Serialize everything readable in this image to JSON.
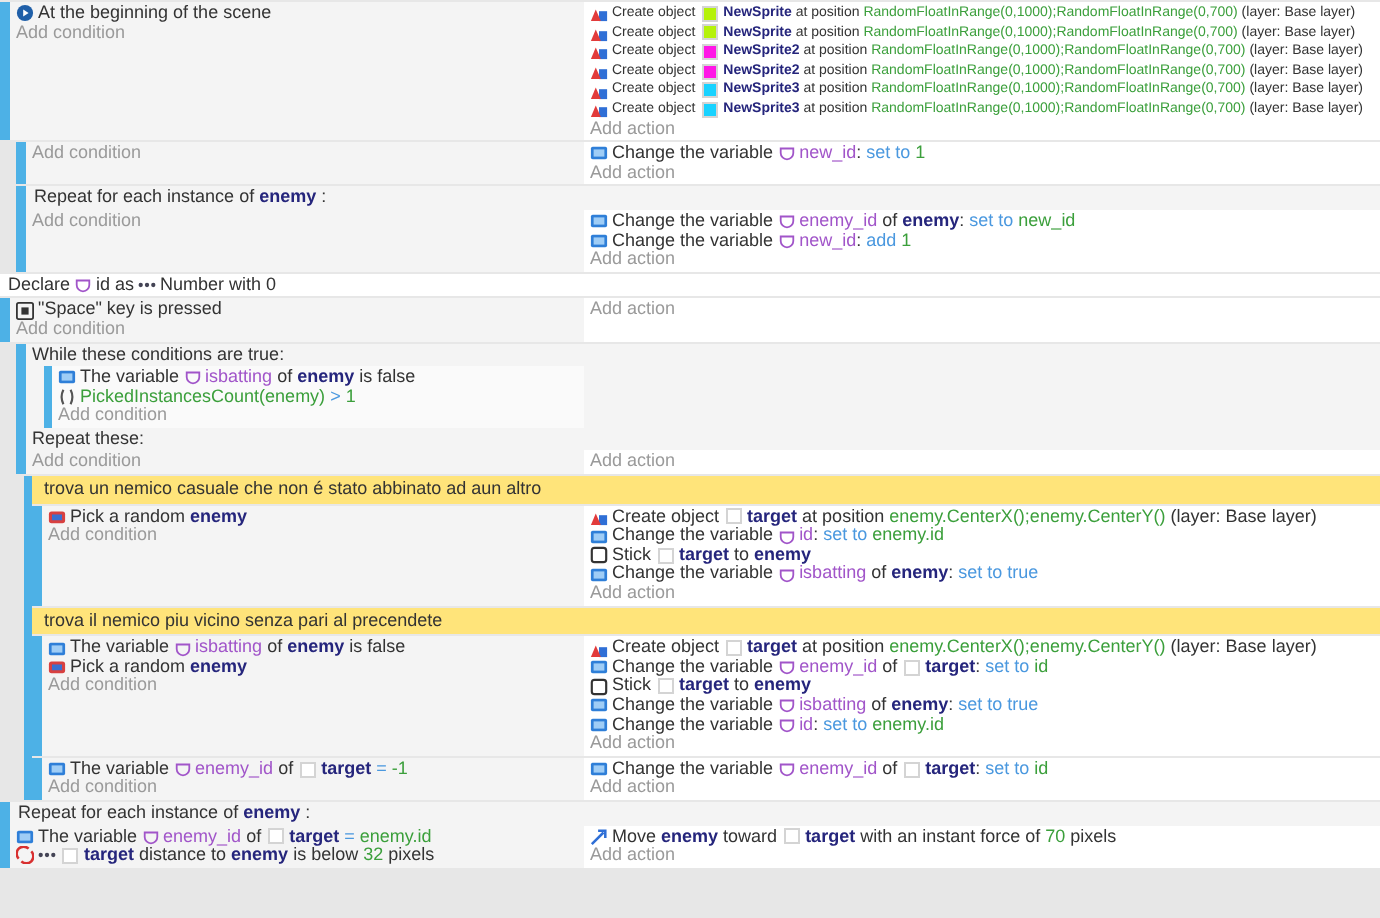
{
  "events": [
    {
      "kind": "standard",
      "conditions": [
        {
          "parts": [
            {
              "kind": "trigger"
            },
            {
              "kind": "text",
              "text": "At the beginning of the scene"
            }
          ]
        }
      ],
      "add_condition": "Add condition",
      "actions": [
        {
          "parts": [
            {
              "kind": "create"
            },
            {
              "kind": "text",
              "text": "Create object"
            },
            {
              "kind": "swatch",
              "color": "#b5f20a"
            },
            {
              "kind": "obj",
              "text": "NewSprite"
            },
            {
              "kind": "text",
              "text": " at position "
            },
            {
              "kind": "expr",
              "text": "RandomFloatInRange(0,1000);RandomFloatInRange(0,700)"
            },
            {
              "kind": "text",
              "text": " (layer: Base layer)"
            }
          ]
        },
        {
          "parts": [
            {
              "kind": "create"
            },
            {
              "kind": "text",
              "text": "Create object"
            },
            {
              "kind": "swatch",
              "color": "#b5f20a"
            },
            {
              "kind": "obj",
              "text": "NewSprite"
            },
            {
              "kind": "text",
              "text": " at position "
            },
            {
              "kind": "expr",
              "text": "RandomFloatInRange(0,1000);RandomFloatInRange(0,700)"
            },
            {
              "kind": "text",
              "text": " (layer: Base layer)"
            }
          ]
        },
        {
          "parts": [
            {
              "kind": "create"
            },
            {
              "kind": "text",
              "text": "Create object"
            },
            {
              "kind": "swatch",
              "color": "#ff16e6"
            },
            {
              "kind": "obj",
              "text": "NewSprite2"
            },
            {
              "kind": "text",
              "text": " at position "
            },
            {
              "kind": "expr",
              "text": "RandomFloatInRange(0,1000);RandomFloatInRange(0,700)"
            },
            {
              "kind": "text",
              "text": " (layer: Base layer)"
            }
          ]
        },
        {
          "parts": [
            {
              "kind": "create"
            },
            {
              "kind": "text",
              "text": "Create object"
            },
            {
              "kind": "swatch",
              "color": "#ff16e6"
            },
            {
              "kind": "obj",
              "text": "NewSprite2"
            },
            {
              "kind": "text",
              "text": " at position "
            },
            {
              "kind": "expr",
              "text": "RandomFloatInRange(0,1000);RandomFloatInRange(0,700)"
            },
            {
              "kind": "text",
              "text": " (layer: Base layer)"
            }
          ]
        },
        {
          "parts": [
            {
              "kind": "create"
            },
            {
              "kind": "text",
              "text": "Create object"
            },
            {
              "kind": "swatch",
              "color": "#18d2ff"
            },
            {
              "kind": "obj",
              "text": "NewSprite3"
            },
            {
              "kind": "text",
              "text": " at position "
            },
            {
              "kind": "expr",
              "text": "RandomFloatInRange(0,1000);RandomFloatInRange(0,700)"
            },
            {
              "kind": "text",
              "text": " (layer: Base layer)"
            }
          ]
        },
        {
          "parts": [
            {
              "kind": "create"
            },
            {
              "kind": "text",
              "text": "Create object"
            },
            {
              "kind": "swatch",
              "color": "#18d2ff"
            },
            {
              "kind": "obj",
              "text": "NewSprite3"
            },
            {
              "kind": "text",
              "text": " at position "
            },
            {
              "kind": "expr",
              "text": "RandomFloatInRange(0,1000);RandomFloatInRange(0,700)"
            },
            {
              "kind": "text",
              "text": " (layer: Base layer)"
            }
          ]
        }
      ],
      "add_action": "Add action",
      "children": [
        {
          "kind": "standard",
          "add_condition": "Add condition",
          "actions": [
            {
              "parts": [
                {
                  "kind": "variable"
                },
                {
                  "kind": "text",
                  "text": "Change the variable"
                },
                {
                  "kind": "scope"
                },
                {
                  "kind": "var",
                  "text": "new_id"
                },
                {
                  "kind": "text",
                  "text": ": "
                },
                {
                  "kind": "op",
                  "text": "set to "
                },
                {
                  "kind": "expr",
                  "text": "1"
                }
              ]
            }
          ],
          "add_action": "Add action"
        },
        {
          "kind": "repeat",
          "header": [
            {
              "kind": "text",
              "text": "Repeat for each instance of "
            },
            {
              "kind": "obj",
              "text": "enemy"
            },
            {
              "kind": "text",
              "text": " :"
            }
          ],
          "add_condition": "Add condition",
          "actions": [
            {
              "parts": [
                {
                  "kind": "variable"
                },
                {
                  "kind": "text",
                  "text": "Change the variable"
                },
                {
                  "kind": "scope"
                },
                {
                  "kind": "var",
                  "text": "enemy_id"
                },
                {
                  "kind": "text",
                  "text": " of "
                },
                {
                  "kind": "obj",
                  "text": "enemy"
                },
                {
                  "kind": "text",
                  "text": ": "
                },
                {
                  "kind": "op",
                  "text": "set to "
                },
                {
                  "kind": "expr",
                  "text": "new_id"
                }
              ]
            },
            {
              "parts": [
                {
                  "kind": "variable"
                },
                {
                  "kind": "text",
                  "text": "Change the variable"
                },
                {
                  "kind": "scope"
                },
                {
                  "kind": "var",
                  "text": "new_id"
                },
                {
                  "kind": "text",
                  "text": ": "
                },
                {
                  "kind": "op",
                  "text": "add "
                },
                {
                  "kind": "expr",
                  "text": "1"
                }
              ]
            }
          ],
          "add_action": "Add action"
        }
      ]
    },
    {
      "kind": "declare",
      "parts": [
        {
          "kind": "text",
          "text": "Declare"
        },
        {
          "kind": "scope"
        },
        {
          "kind": "text",
          "text": "id as"
        },
        {
          "kind": "dots"
        },
        {
          "kind": "text",
          "text": "Number with 0"
        }
      ]
    },
    {
      "kind": "standard",
      "conditions": [
        {
          "parts": [
            {
              "kind": "keyboard"
            },
            {
              "kind": "text",
              "text": "\"Space\" key is pressed"
            }
          ]
        }
      ],
      "add_condition": "Add condition",
      "add_action": "Add action",
      "children": [
        {
          "kind": "while",
          "header": "While these conditions are true:",
          "while_conditions": [
            {
              "parts": [
                {
                  "kind": "variable"
                },
                {
                  "kind": "text",
                  "text": "The variable"
                },
                {
                  "kind": "scope"
                },
                {
                  "kind": "var",
                  "text": "isbatting"
                },
                {
                  "kind": "text",
                  "text": " of "
                },
                {
                  "kind": "obj",
                  "text": "enemy"
                },
                {
                  "kind": "text",
                  "text": " is false"
                }
              ]
            },
            {
              "parts": [
                {
                  "kind": "func"
                },
                {
                  "kind": "expr",
                  "text": "PickedInstancesCount(enemy)"
                },
                {
                  "kind": "op",
                  "text": " > "
                },
                {
                  "kind": "expr",
                  "text": "1"
                }
              ]
            }
          ],
          "add_while_condition": "Add condition",
          "repeat_label": "Repeat these:",
          "add_condition": "Add condition",
          "add_action": "Add action",
          "children": [
            {
              "kind": "comment",
              "text": "trova un nemico casuale che non é stato abbinato ad aun altro"
            },
            {
              "kind": "standard",
              "conditions": [
                {
                  "parts": [
                    {
                      "kind": "pick"
                    },
                    {
                      "kind": "text",
                      "text": "Pick a random "
                    },
                    {
                      "kind": "obj",
                      "text": "enemy"
                    }
                  ]
                }
              ],
              "add_condition": "Add condition",
              "actions": [
                {
                  "parts": [
                    {
                      "kind": "create"
                    },
                    {
                      "kind": "text",
                      "text": "Create object"
                    },
                    {
                      "kind": "swatch",
                      "color": "#ffffff"
                    },
                    {
                      "kind": "obj",
                      "text": "target"
                    },
                    {
                      "kind": "text",
                      "text": " at position "
                    },
                    {
                      "kind": "expr",
                      "text": "enemy.CenterX();enemy.CenterY()"
                    },
                    {
                      "kind": "text",
                      "text": " (layer: Base layer)"
                    }
                  ]
                },
                {
                  "parts": [
                    {
                      "kind": "variable"
                    },
                    {
                      "kind": "text",
                      "text": "Change the variable"
                    },
                    {
                      "kind": "scope"
                    },
                    {
                      "kind": "var",
                      "text": "id"
                    },
                    {
                      "kind": "text",
                      "text": ": "
                    },
                    {
                      "kind": "op",
                      "text": "set to "
                    },
                    {
                      "kind": "expr",
                      "text": "enemy.id"
                    }
                  ]
                },
                {
                  "parts": [
                    {
                      "kind": "stick"
                    },
                    {
                      "kind": "text",
                      "text": "Stick"
                    },
                    {
                      "kind": "swatch",
                      "color": "#ffffff"
                    },
                    {
                      "kind": "obj",
                      "text": "target"
                    },
                    {
                      "kind": "text",
                      "text": " to "
                    },
                    {
                      "kind": "obj",
                      "text": "enemy"
                    }
                  ]
                },
                {
                  "parts": [
                    {
                      "kind": "variable"
                    },
                    {
                      "kind": "text",
                      "text": "Change the variable"
                    },
                    {
                      "kind": "scope"
                    },
                    {
                      "kind": "var",
                      "text": "isbatting"
                    },
                    {
                      "kind": "text",
                      "text": " of "
                    },
                    {
                      "kind": "obj",
                      "text": "enemy"
                    },
                    {
                      "kind": "text",
                      "text": ": "
                    },
                    {
                      "kind": "op",
                      "text": "set to true"
                    }
                  ]
                }
              ],
              "add_action": "Add action"
            },
            {
              "kind": "comment",
              "text": "trova il nemico piu vicino senza pari al precendete"
            },
            {
              "kind": "standard",
              "conditions": [
                {
                  "parts": [
                    {
                      "kind": "variable"
                    },
                    {
                      "kind": "text",
                      "text": "The variable"
                    },
                    {
                      "kind": "scope"
                    },
                    {
                      "kind": "var",
                      "text": "isbatting"
                    },
                    {
                      "kind": "text",
                      "text": " of "
                    },
                    {
                      "kind": "obj",
                      "text": "enemy"
                    },
                    {
                      "kind": "text",
                      "text": " is false"
                    }
                  ]
                },
                {
                  "parts": [
                    {
                      "kind": "pick"
                    },
                    {
                      "kind": "text",
                      "text": "Pick a random "
                    },
                    {
                      "kind": "obj",
                      "text": "enemy"
                    }
                  ]
                }
              ],
              "add_condition": "Add condition",
              "actions": [
                {
                  "parts": [
                    {
                      "kind": "create"
                    },
                    {
                      "kind": "text",
                      "text": "Create object"
                    },
                    {
                      "kind": "swatch",
                      "color": "#ffffff"
                    },
                    {
                      "kind": "obj",
                      "text": "target"
                    },
                    {
                      "kind": "text",
                      "text": " at position "
                    },
                    {
                      "kind": "expr",
                      "text": "enemy.CenterX();enemy.CenterY()"
                    },
                    {
                      "kind": "text",
                      "text": " (layer: Base layer)"
                    }
                  ]
                },
                {
                  "parts": [
                    {
                      "kind": "variable"
                    },
                    {
                      "kind": "text",
                      "text": "Change the variable"
                    },
                    {
                      "kind": "scope"
                    },
                    {
                      "kind": "var",
                      "text": "enemy_id"
                    },
                    {
                      "kind": "text",
                      "text": " of"
                    },
                    {
                      "kind": "swatch",
                      "color": "#ffffff"
                    },
                    {
                      "kind": "obj",
                      "text": "target"
                    },
                    {
                      "kind": "text",
                      "text": ": "
                    },
                    {
                      "kind": "op",
                      "text": "set to "
                    },
                    {
                      "kind": "expr",
                      "text": "id"
                    }
                  ]
                },
                {
                  "parts": [
                    {
                      "kind": "stick"
                    },
                    {
                      "kind": "text",
                      "text": "Stick"
                    },
                    {
                      "kind": "swatch",
                      "color": "#ffffff"
                    },
                    {
                      "kind": "obj",
                      "text": "target"
                    },
                    {
                      "kind": "text",
                      "text": " to "
                    },
                    {
                      "kind": "obj",
                      "text": "enemy"
                    }
                  ]
                },
                {
                  "parts": [
                    {
                      "kind": "variable"
                    },
                    {
                      "kind": "text",
                      "text": "Change the variable"
                    },
                    {
                      "kind": "scope"
                    },
                    {
                      "kind": "var",
                      "text": "isbatting"
                    },
                    {
                      "kind": "text",
                      "text": " of "
                    },
                    {
                      "kind": "obj",
                      "text": "enemy"
                    },
                    {
                      "kind": "text",
                      "text": ": "
                    },
                    {
                      "kind": "op",
                      "text": "set to true"
                    }
                  ]
                },
                {
                  "parts": [
                    {
                      "kind": "variable"
                    },
                    {
                      "kind": "text",
                      "text": "Change the variable"
                    },
                    {
                      "kind": "scope"
                    },
                    {
                      "kind": "var",
                      "text": "id"
                    },
                    {
                      "kind": "text",
                      "text": ": "
                    },
                    {
                      "kind": "op",
                      "text": "set to "
                    },
                    {
                      "kind": "expr",
                      "text": "enemy.id"
                    }
                  ]
                }
              ],
              "add_action": "Add action"
            },
            {
              "kind": "standard",
              "conditions": [
                {
                  "parts": [
                    {
                      "kind": "variable"
                    },
                    {
                      "kind": "text",
                      "text": "The variable"
                    },
                    {
                      "kind": "scope"
                    },
                    {
                      "kind": "var",
                      "text": "enemy_id"
                    },
                    {
                      "kind": "text",
                      "text": " of"
                    },
                    {
                      "kind": "swatch",
                      "color": "#ffffff"
                    },
                    {
                      "kind": "obj",
                      "text": "target"
                    },
                    {
                      "kind": "op",
                      "text": " = "
                    },
                    {
                      "kind": "expr",
                      "text": "-1"
                    }
                  ]
                }
              ],
              "add_condition": "Add condition",
              "actions": [
                {
                  "parts": [
                    {
                      "kind": "variable"
                    },
                    {
                      "kind": "text",
                      "text": "Change the variable"
                    },
                    {
                      "kind": "scope"
                    },
                    {
                      "kind": "var",
                      "text": "enemy_id"
                    },
                    {
                      "kind": "text",
                      "text": " of"
                    },
                    {
                      "kind": "swatch",
                      "color": "#ffffff"
                    },
                    {
                      "kind": "obj",
                      "text": "target"
                    },
                    {
                      "kind": "text",
                      "text": ": "
                    },
                    {
                      "kind": "op",
                      "text": "set to "
                    },
                    {
                      "kind": "expr",
                      "text": "id"
                    }
                  ]
                }
              ],
              "add_action": "Add action"
            }
          ]
        }
      ]
    },
    {
      "kind": "repeat",
      "header": [
        {
          "kind": "text",
          "text": "Repeat for each instance of "
        },
        {
          "kind": "obj",
          "text": "enemy"
        },
        {
          "kind": "text",
          "text": " :"
        }
      ],
      "conditions": [
        {
          "parts": [
            {
              "kind": "variable"
            },
            {
              "kind": "text",
              "text": "The variable"
            },
            {
              "kind": "scope"
            },
            {
              "kind": "var",
              "text": "enemy_id"
            },
            {
              "kind": "text",
              "text": " of"
            },
            {
              "kind": "swatch",
              "color": "#ffffff"
            },
            {
              "kind": "obj",
              "text": "target"
            },
            {
              "kind": "op",
              "text": " = "
            },
            {
              "kind": "expr",
              "text": "enemy.id"
            }
          ]
        },
        {
          "parts": [
            {
              "kind": "distance"
            },
            {
              "kind": "dots"
            },
            {
              "kind": "swatch",
              "color": "#ffffff"
            },
            {
              "kind": "obj",
              "text": "target"
            },
            {
              "kind": "text",
              "text": " distance to "
            },
            {
              "kind": "obj",
              "text": "enemy"
            },
            {
              "kind": "text",
              "text": " is below "
            },
            {
              "kind": "expr",
              "text": "32"
            },
            {
              "kind": "text",
              "text": " pixels"
            }
          ]
        }
      ],
      "actions": [
        {
          "parts": [
            {
              "kind": "force"
            },
            {
              "kind": "text",
              "text": "Move "
            },
            {
              "kind": "obj",
              "text": "enemy"
            },
            {
              "kind": "text",
              "text": " toward"
            },
            {
              "kind": "swatch",
              "color": "#ffffff"
            },
            {
              "kind": "obj",
              "text": "target"
            },
            {
              "kind": "text",
              "text": " with an instant force of "
            },
            {
              "kind": "expr",
              "text": "70"
            },
            {
              "kind": "text",
              "text": " pixels"
            }
          ]
        }
      ],
      "add_action": "Add action"
    }
  ]
}
